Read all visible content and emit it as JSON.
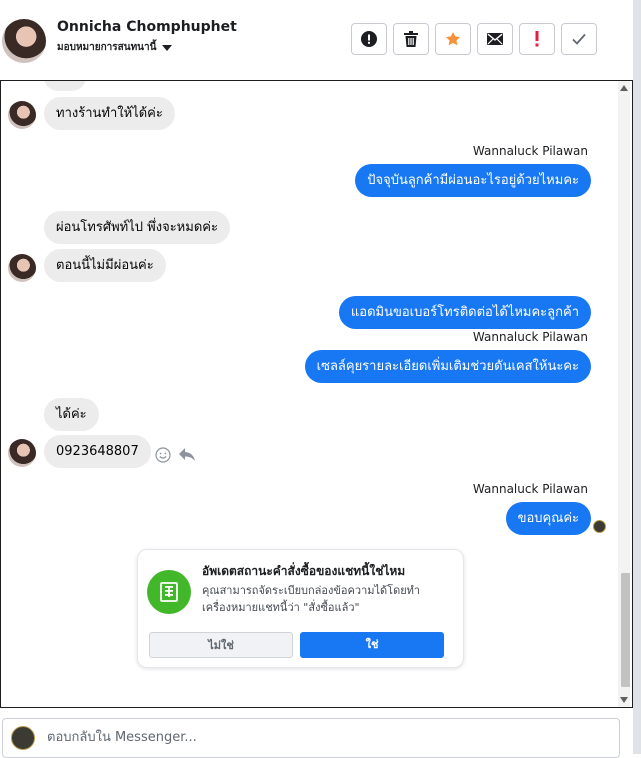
{
  "header": {
    "contact_name": "Onnicha Chomphuphet",
    "assign_label": "มอบหมายการสนทนานี้",
    "actions": [
      {
        "name": "info-button",
        "icon": "exclamation-circle-icon"
      },
      {
        "name": "delete-button",
        "icon": "trash-icon"
      },
      {
        "name": "star-button",
        "icon": "star-icon"
      },
      {
        "name": "mail-button",
        "icon": "envelope-icon"
      },
      {
        "name": "mark-spam-button",
        "icon": "exclamation-icon"
      },
      {
        "name": "done-button",
        "icon": "check-icon"
      }
    ]
  },
  "messages": [
    {
      "from": "customer",
      "text": "ทางร้านทำให้ได้ค่ะ"
    },
    {
      "from": "page",
      "sender": "Wannaluck Pilawan",
      "text": "ปัจจุบันลูกค้ามีผ่อนอะไรอยู่ด้วยไหมคะ"
    },
    {
      "from": "customer",
      "text": "ผ่อนโทรศัพท์ไป พึ่งจะหมดค่ะ"
    },
    {
      "from": "customer",
      "text": "ตอนนี้ไม่มีผ่อนค่ะ"
    },
    {
      "from": "page",
      "text": "แอดมินขอเบอร์โทรติดต่อได้ไหมคะลูกค้า"
    },
    {
      "from": "page",
      "sender": "Wannaluck Pilawan",
      "text": "เซลล์คุยรายละเอียดเพิ่มเติมช่วยดันเคสให้นะคะ"
    },
    {
      "from": "customer",
      "text": "ได้ค่ะ"
    },
    {
      "from": "customer",
      "text": "0923648807"
    },
    {
      "from": "page",
      "sender": "Wannaluck Pilawan",
      "text": "ขอบคุณค่ะ"
    }
  ],
  "order_card": {
    "title": "อัพเดตสถานะคำสั่งซื้อของแชทนี้ใช่ไหม",
    "body": "คุณสามารถจัดระเบียบกล่องข้อความได้โดยทำเครื่องหมายแชทนี้ว่า \"สั่งซื้อแล้ว\"",
    "no_label": "ไม่ใช่",
    "yes_label": "ใช่"
  },
  "reply": {
    "placeholder": "ตอบกลับใน Messenger..."
  },
  "colors": {
    "outgoing_bubble": "#1877f2",
    "incoming_bubble": "#ececec",
    "card_icon": "#42b72a",
    "star": "#f7923a",
    "alert": "#e41e3f"
  }
}
